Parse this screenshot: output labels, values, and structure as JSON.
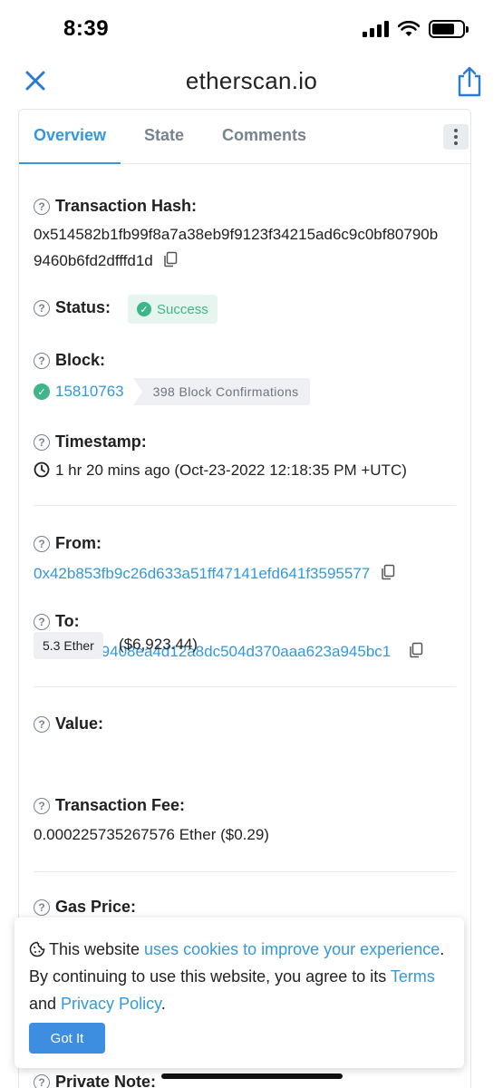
{
  "status_bar": {
    "time": "8:39"
  },
  "browser": {
    "url": "etherscan.io"
  },
  "tabs": [
    {
      "label": "Overview"
    },
    {
      "label": "State"
    },
    {
      "label": "Comments"
    }
  ],
  "fields": {
    "tx_hash": {
      "label": "Transaction Hash:",
      "value_line1": "0x514582b1fb99f8a7a38eb9f9123f34215ad6c9c0bf80790b",
      "value_line2": "9460b6fd2dfffd1d"
    },
    "status": {
      "label": "Status:",
      "badge": "Success"
    },
    "block": {
      "label": "Block:",
      "number": "15810763",
      "confirmations": "398 Block Confirmations"
    },
    "timestamp": {
      "label": "Timestamp:",
      "value": "1 hr 20 mins ago (Oct-23-2022 12:18:35 PM +UTC)"
    },
    "from": {
      "label": "From:",
      "value": "0x42b853fb9c26d633a51ff47141efd641f3595577"
    },
    "to": {
      "label": "To:",
      "value": "0x9143149408ea4d12a8dc504d370aaa623a945bc1"
    },
    "value": {
      "label": "Value:",
      "amount": "5.3 Ether",
      "usd": "($6,923.44)"
    },
    "fee": {
      "label": "Transaction Fee:",
      "value": "0.000225735267576 Ether ($0.29)"
    },
    "gas": {
      "label": "Gas Price:"
    },
    "note": {
      "label": "Private Note:"
    }
  },
  "cookie": {
    "text1": "This website ",
    "link1": "uses cookies to improve your experience",
    "text2": ". By continuing to use this website, you agree to its ",
    "link_terms": "Terms",
    "text3": " and ",
    "link_privacy": "Privacy Policy",
    "text4": ".",
    "button": "Got It"
  },
  "colors": {
    "accent": "#3498db",
    "success": "#3fb58b",
    "button": "#3d8ee0"
  }
}
